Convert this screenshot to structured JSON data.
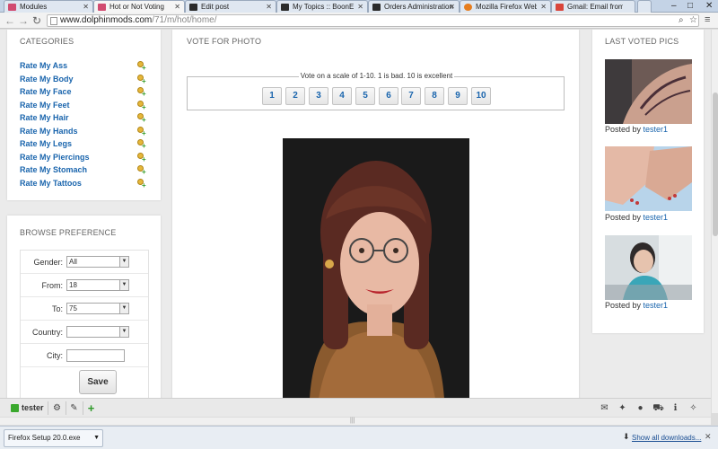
{
  "browser": {
    "tabs": [
      {
        "label": "Modules",
        "favicon_color": "#d14b70"
      },
      {
        "label": "Hot or Not Voting",
        "favicon_color": "#d14b70",
        "active": true
      },
      {
        "label": "Edit post",
        "favicon_color": "#2b2b2b"
      },
      {
        "label": "My Topics :: BoonEx Unit",
        "favicon_color": "#2b2b2b"
      },
      {
        "label": "Orders Administration",
        "favicon_color": "#2b2b2b"
      },
      {
        "label": "Mozilla Firefox Web Brow",
        "favicon_color": "#e67d1e"
      },
      {
        "label": "Gmail: Email from Goog",
        "favicon_color": "#d9453b"
      }
    ],
    "url_host": "www.dolphinmods.com",
    "url_path": "/71/m/hot/home/"
  },
  "categories": {
    "title": "CATEGORIES",
    "items": [
      "Rate My Ass",
      "Rate My Body",
      "Rate My Face",
      "Rate My Feet",
      "Rate My Hair",
      "Rate My Hands",
      "Rate My Legs",
      "Rate My Piercings",
      "Rate My Stomach",
      "Rate My Tattoos"
    ]
  },
  "browse": {
    "title": "BROWSE PREFERENCE",
    "gender_label": "Gender:",
    "gender_value": "All",
    "from_label": "From:",
    "from_value": "18",
    "to_label": "To:",
    "to_value": "75",
    "country_label": "Country:",
    "country_value": "",
    "city_label": "City:",
    "save_label": "Save"
  },
  "vote": {
    "title": "VOTE FOR PHOTO",
    "instructions": "Vote on a scale of 1-10. 1 is bad. 10 is excellent",
    "scale": [
      "1",
      "2",
      "3",
      "4",
      "5",
      "6",
      "7",
      "8",
      "9",
      "10"
    ]
  },
  "last_voted": {
    "title": "LAST VOTED PICS",
    "posted_prefix": "Posted by",
    "items": [
      {
        "user": "tester1"
      },
      {
        "user": "tester1"
      },
      {
        "user": "tester1"
      }
    ]
  },
  "admin_bar": {
    "username": "tester"
  },
  "downloads": {
    "file": "Firefox Setup 20.0.exe",
    "show_all": "Show all downloads..."
  }
}
